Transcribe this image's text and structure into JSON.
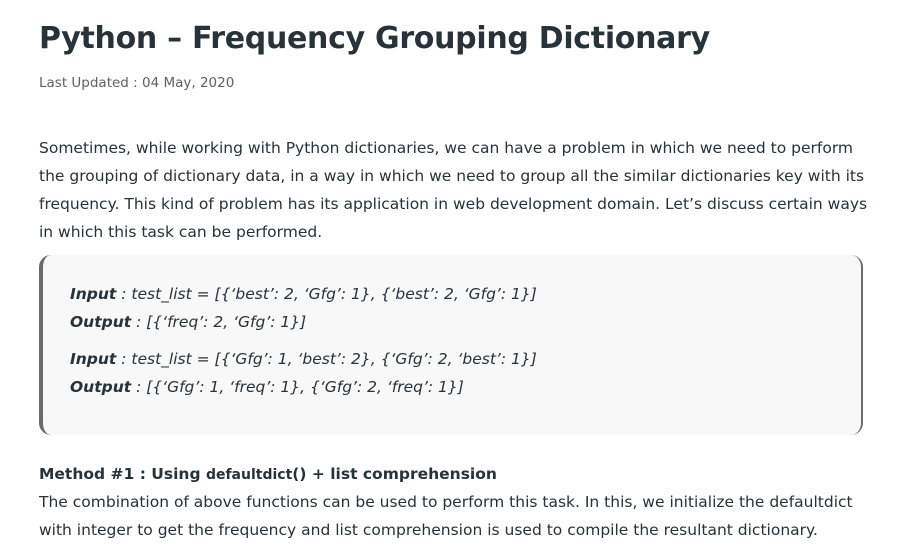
{
  "article": {
    "title": "Python – Frequency Grouping Dictionary",
    "last_updated": "Last Updated : 04 May, 2020",
    "intro": "Sometimes, while working with Python dictionaries, we can have a problem in which we need to perform the grouping of dictionary data, in a way in which we need to group all the similar dictionaries key with its frequency. This kind of problem has its application in web development domain. Let’s discuss certain ways in which this task can be performed."
  },
  "examples": [
    {
      "input_label": "Input",
      "input_value": " : test_list = [{‘best’: 2, ‘Gfg’: 1}, {‘best’: 2, ‘Gfg’: 1}]",
      "output_label": "Output",
      "output_value": " : [{‘freq’: 2, ‘Gfg’: 1}]"
    },
    {
      "input_label": "Input",
      "input_value": " : test_list = [{‘Gfg’: 1, ‘best’: 2}, {‘Gfg’: 2, ‘best’: 1}]",
      "output_label": "Output",
      "output_value": " : [{‘Gfg’: 1, ‘freq’: 1}, {‘Gfg’: 2, ‘freq’: 1}]"
    }
  ],
  "method": {
    "heading_prefix": "Method #1 : Using ",
    "heading_code": "defaultdict",
    "heading_suffix": "() + list comprehension",
    "text": "The combination of above functions can be used to perform this task. In this, we initialize the defaultdict with integer to get the frequency and list comprehension is used to compile the resultant dictionary."
  }
}
